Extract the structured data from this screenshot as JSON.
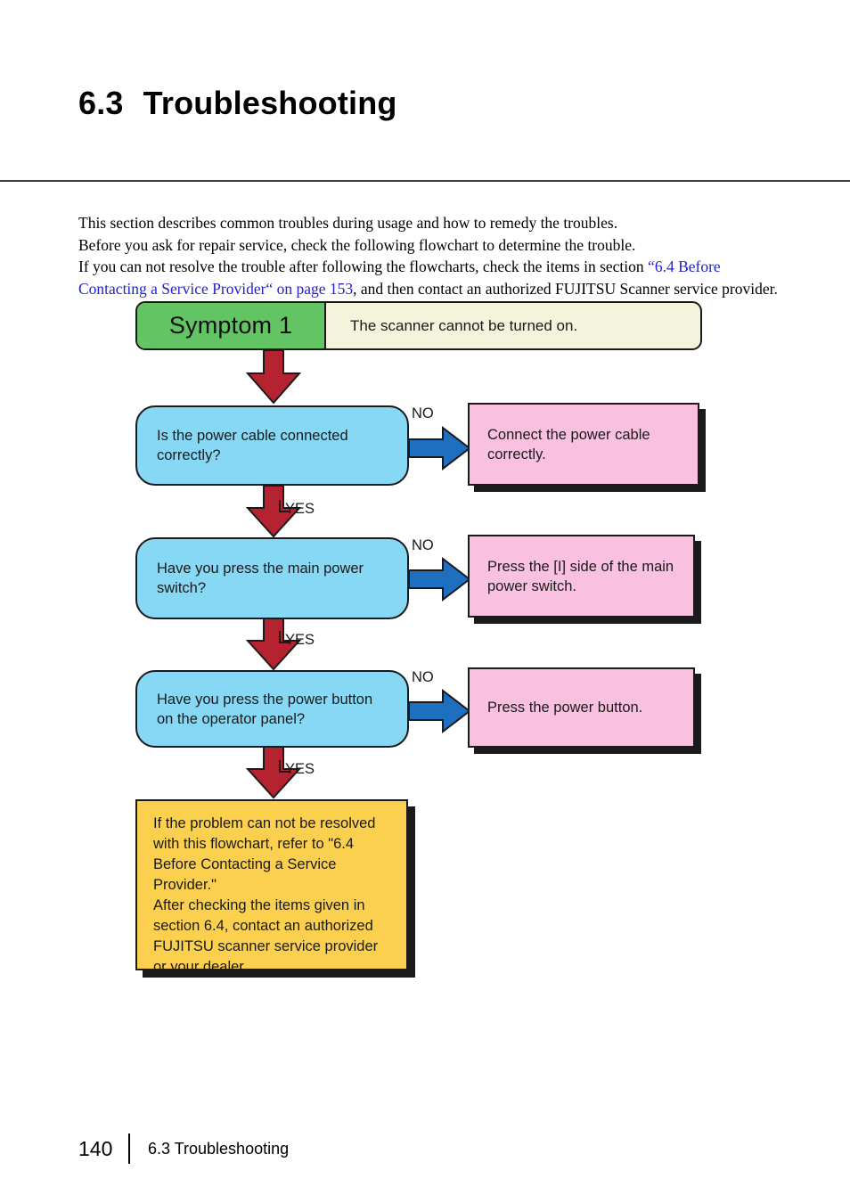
{
  "heading": {
    "section_number": "6.3",
    "title": "Troubleshooting"
  },
  "intro": {
    "line1": "This section describes common troubles during usage and how to remedy the troubles.",
    "line2": "Before you ask for repair service, check the following flowchart to determine the trouble.",
    "line3_part1": "If you can not resolve the trouble after following the flowcharts, check the items in section ",
    "link_text": "“6.4  Before Contacting a Service Provider“ on page 153",
    "line3_part2": ", and then contact an authorized FUJITSU Scanner service provider."
  },
  "flowchart": {
    "symptom": {
      "label": "Symptom 1",
      "description": "The scanner cannot be turned on."
    },
    "steps": [
      {
        "question": "Is the power cable connected correctly?",
        "no_label": "NO",
        "yes_label": "YES",
        "action": "Connect the power cable correctly."
      },
      {
        "question": "Have you press the main power switch?",
        "no_label": "NO",
        "yes_label": "YES",
        "action": "Press the [I] side of the main power switch."
      },
      {
        "question": "Have you press the power button on the operator panel?",
        "no_label": "NO",
        "yes_label": "YES",
        "action": "Press the power button."
      }
    ],
    "final_note": "If the problem can not be resolved with this flowchart, refer to \"6.4 Before Contacting a Service Provider.\"\nAfter checking the items given in section 6.4,  contact an authorized FUJITSU scanner service provider or your dealer."
  },
  "footer": {
    "page_number": "140",
    "section_title": "6.3 Troubleshooting"
  },
  "colors": {
    "symptom_label_green": "#62c462",
    "symptom_body_cream": "#f4f4dc",
    "decision_blue": "#87d8f5",
    "action_pink": "#fac0e0",
    "note_yellow": "#fcd04f",
    "down_arrow_red": "#b52230",
    "right_arrow_blue": "#1f6fc0",
    "link_blue": "#2222cc",
    "outline_black": "#1a1a1a"
  }
}
